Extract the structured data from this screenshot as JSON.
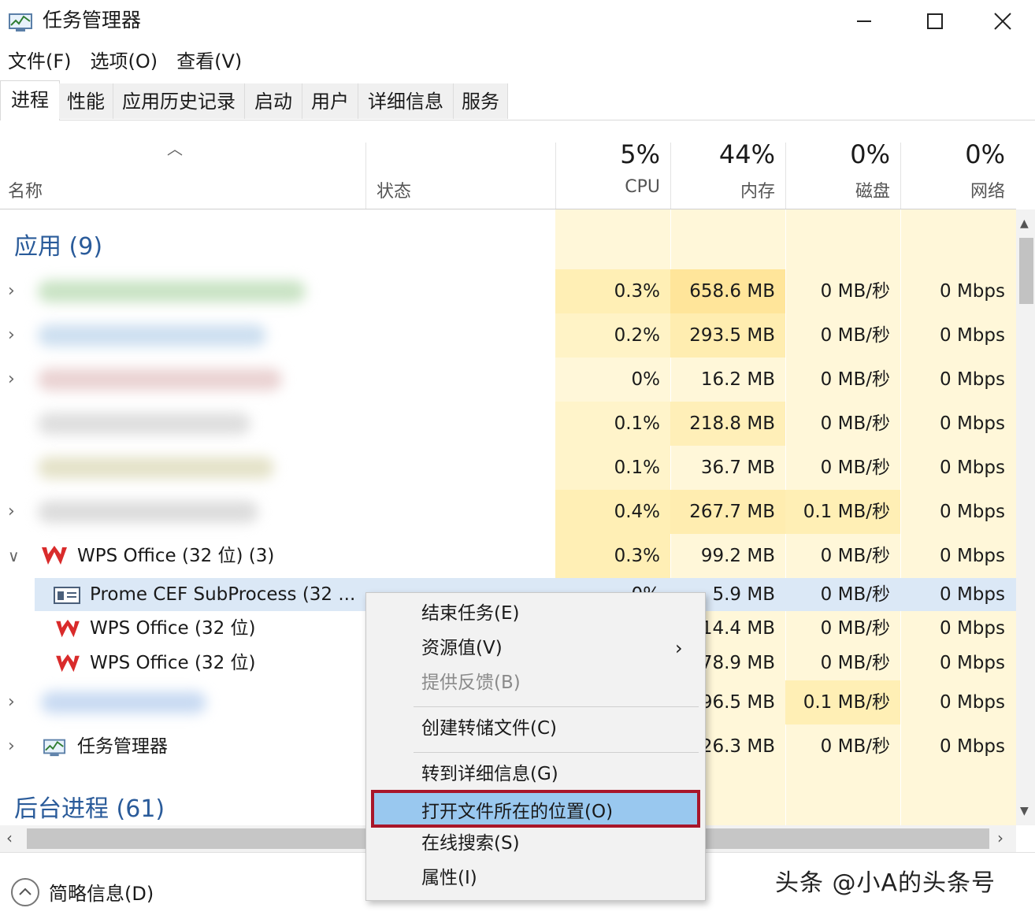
{
  "window": {
    "title": "任务管理器"
  },
  "menu": [
    "文件(F)",
    "选项(O)",
    "查看(V)"
  ],
  "tabs": [
    "进程",
    "性能",
    "应用历史记录",
    "启动",
    "用户",
    "详细信息",
    "服务"
  ],
  "columns": {
    "name": "名称",
    "status": "状态",
    "cpu": {
      "pct": "5%",
      "label": "CPU"
    },
    "memory": {
      "pct": "44%",
      "label": "内存"
    },
    "disk": {
      "pct": "0%",
      "label": "磁盘"
    },
    "network": {
      "pct": "0%",
      "label": "网络"
    }
  },
  "groups": {
    "apps": "应用 (9)",
    "background": "后台进程 (61)"
  },
  "rows": [
    {
      "cpu": "0.3%",
      "mem": "658.6 MB",
      "disk": "0 MB/秒",
      "net": "0 Mbps"
    },
    {
      "cpu": "0.2%",
      "mem": "293.5 MB",
      "disk": "0 MB/秒",
      "net": "0 Mbps"
    },
    {
      "cpu": "0%",
      "mem": "16.2 MB",
      "disk": "0 MB/秒",
      "net": "0 Mbps"
    },
    {
      "cpu": "0.1%",
      "mem": "218.8 MB",
      "disk": "0 MB/秒",
      "net": "0 Mbps"
    },
    {
      "cpu": "0.1%",
      "mem": "36.7 MB",
      "disk": "0 MB/秒",
      "net": "0 Mbps"
    },
    {
      "cpu": "0.4%",
      "mem": "267.7 MB",
      "disk": "0.1 MB/秒",
      "net": "0 Mbps"
    },
    {
      "name": "WPS Office (32 位) (3)",
      "cpu": "0.3%",
      "mem": "99.2 MB",
      "disk": "0 MB/秒",
      "net": "0 Mbps"
    },
    {
      "name": "Prome CEF SubProcess (32 ...",
      "cpu": "0%",
      "mem": "5.9 MB",
      "disk": "0 MB/秒",
      "net": "0 Mbps"
    },
    {
      "name": "WPS Office (32 位)",
      "mem": "14.4 MB",
      "disk": "0 MB/秒",
      "net": "0 Mbps"
    },
    {
      "name": "WPS Office (32 位)",
      "mem": "78.9 MB",
      "disk": "0 MB/秒",
      "net": "0 Mbps"
    },
    {
      "mem": "96.5 MB",
      "disk": "0.1 MB/秒",
      "net": "0 Mbps"
    },
    {
      "name": "任务管理器",
      "mem": "26.3 MB",
      "disk": "0 MB/秒",
      "net": "0 Mbps"
    }
  ],
  "context_menu": {
    "items": [
      "结束任务(E)",
      "资源值(V)",
      "提供反馈(B)",
      "创建转储文件(C)",
      "转到详细信息(G)",
      "打开文件所在的位置(O)",
      "在线搜索(S)",
      "属性(I)"
    ],
    "highlighted": "打开文件所在的位置(O)"
  },
  "footer": {
    "less_details": "简略信息(D)"
  },
  "watermark": "头条 @小A的头条号",
  "colors": {
    "heat_light": "#fff7d9",
    "heat_mid": "#fff0b8",
    "heat_strong": "#ffe9a0",
    "group_blue": "#2a5b9a",
    "selected_row": "#dbe8f6",
    "highlight_box": "#a8162a",
    "highlight_fill": "#99c8ef",
    "wps_red": "#d92b2b"
  }
}
